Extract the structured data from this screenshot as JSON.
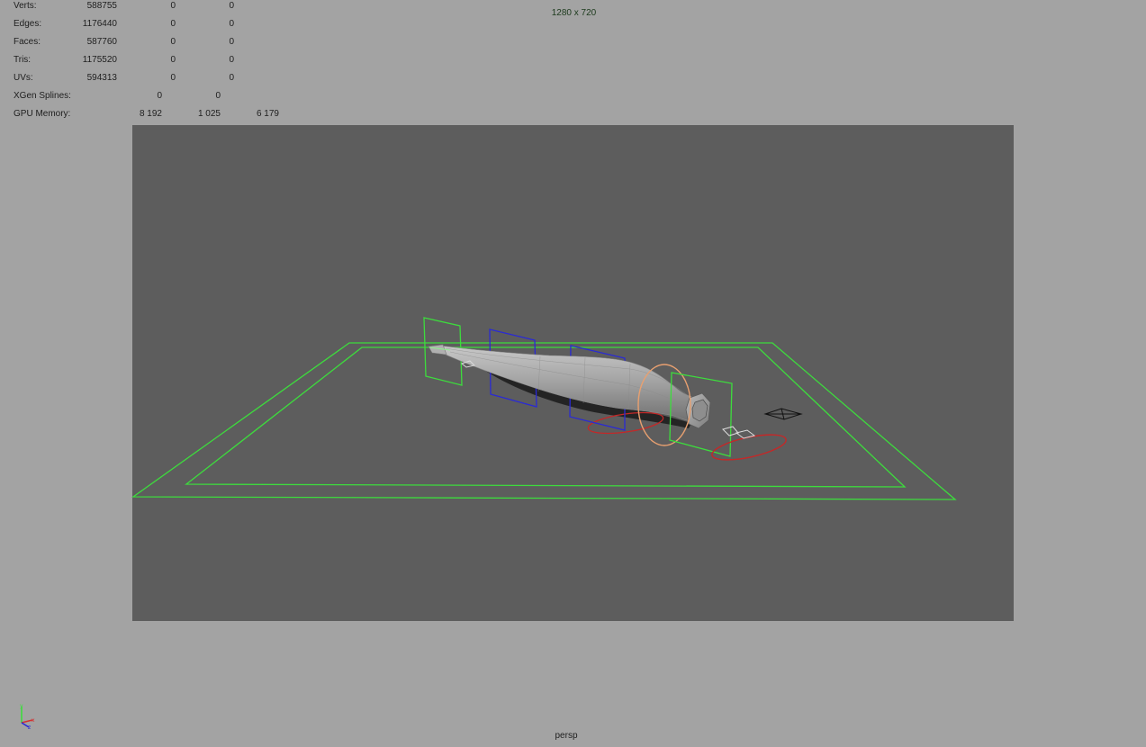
{
  "hud": {
    "rows": [
      {
        "label": "Verts:",
        "v0": "588755",
        "v1": "0",
        "v2": "0"
      },
      {
        "label": "Edges:",
        "v0": "1176440",
        "v1": "0",
        "v2": "0"
      },
      {
        "label": "Faces:",
        "v0": "587760",
        "v1": "0",
        "v2": "0"
      },
      {
        "label": "Tris:",
        "v0": "1175520",
        "v1": "0",
        "v2": "0"
      },
      {
        "label": "UVs:",
        "v0": "594313",
        "v1": "0",
        "v2": "0"
      },
      {
        "label": "XGen Splines:",
        "v0": "0",
        "v1": "0",
        "v2": ""
      },
      {
        "label": "GPU Memory:",
        "v0": "8 192",
        "v1": "1 025",
        "v2": "6 179"
      }
    ]
  },
  "viewport": {
    "resolution": "1280 x 720",
    "camera": "persp",
    "background_color": "#a3a3a3",
    "gate_color": "#5d5d5d"
  },
  "colors": {
    "grid_green": "#3ddc3d",
    "plane_blue": "#2a2ad4",
    "ring_orange": "#e8a070",
    "ring_red": "#c42828",
    "mesh_grey": "#a8a8a8"
  },
  "icons": {
    "axis": "xyz-axis-icon",
    "locator": "locator-icon"
  }
}
